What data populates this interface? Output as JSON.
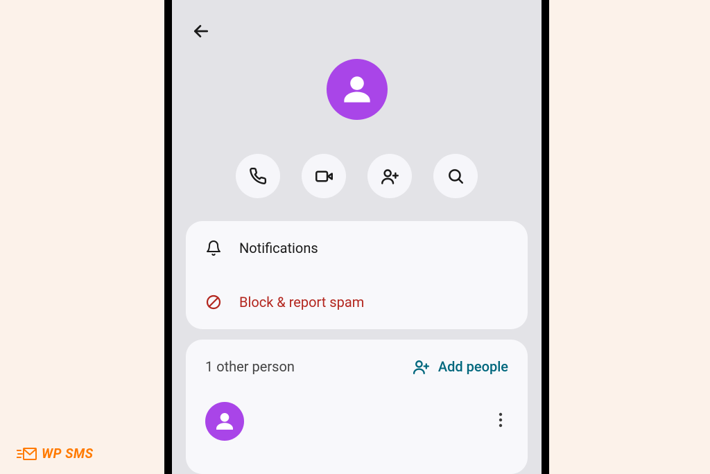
{
  "colors": {
    "accent_purple": "#a945e8",
    "danger": "#b3261e",
    "teal": "#00677d",
    "logo_orange": "#ff7a00"
  },
  "settings": {
    "notifications_label": "Notifications",
    "block_label": "Block & report spam"
  },
  "people_section": {
    "other_count_label": "1 other person",
    "add_label": "Add people"
  },
  "logo": {
    "text": "WP SMS"
  }
}
